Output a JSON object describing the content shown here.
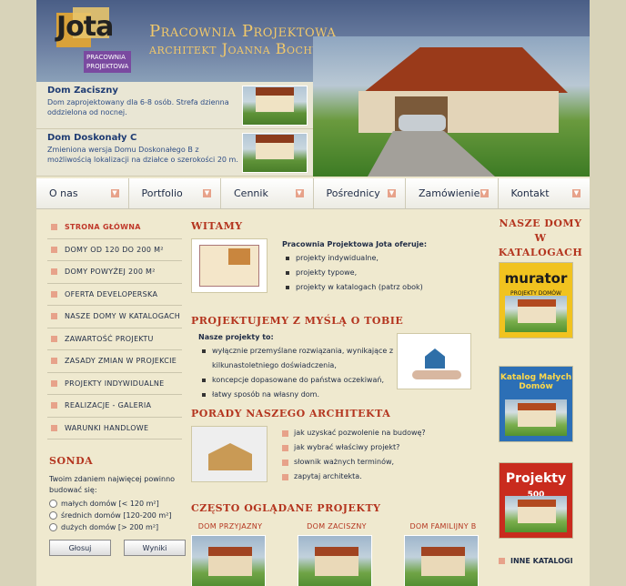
{
  "header": {
    "logo_text": "Jota",
    "logo_tag": "Pracownia Projektowa",
    "title": "Pracownia Projektowa",
    "subtitle": "architekt Joanna Bochyńska"
  },
  "featured": [
    {
      "title": "Dom Zaciszny",
      "desc": "Dom zaprojektowany dla 6-8 osób. Strefa dzienna oddzielona od nocnej."
    },
    {
      "title": "Dom Doskonały C",
      "desc": "Zmieniona wersja Domu Doskonałego B z możliwością lokalizacji na działce o szerokości 20 m."
    }
  ],
  "nav": [
    "O nas",
    "Portfolio",
    "Cennik",
    "Pośrednicy",
    "Zamówienie",
    "Kontakt"
  ],
  "sidebar": [
    "Strona główna",
    "Domy od 120 do 200 m²",
    "Domy powyżej 200 m²",
    "Oferta developerska",
    "Nasze domy w katalogach",
    "Zawartość projektu",
    "Zasady zmian w projekcie",
    "Projekty indywidualne",
    "Realizacje - Galeria",
    "Warunki handlowe"
  ],
  "sonda": {
    "title": "Sonda",
    "question": "Twoim zdaniem najwięcej powinno budować się:",
    "options": [
      "małych domów [< 120 m²]",
      "średnich domów [120-200 m²]",
      "dużych domów [> 200 m²]"
    ],
    "vote": "Głosuj",
    "results": "Wyniki"
  },
  "welcome": {
    "title": "Witamy",
    "intro": "Pracownia Projektowa Jota oferuje:",
    "items": [
      "projekty indywidualne,",
      "projekty typowe,",
      "projekty w katalogach (patrz obok)"
    ]
  },
  "design": {
    "title": "Projektujemy z myślą o tobie",
    "intro": "Nasze projekty to:",
    "items": [
      "wyłącznie przemyślane rozwiązania, wynikające z",
      "kilkunastoletniego doświadczenia,",
      "koncepcje dopasowane do państwa oczekiwań,",
      "łatwy sposób na własny dom."
    ]
  },
  "advice": {
    "title": "Porady naszego architekta",
    "items": [
      "jak uzyskać pozwolenie na budowę?",
      "jak wybrać właściwy projekt?",
      "słownik ważnych terminów,",
      "zapytaj architekta."
    ]
  },
  "popular": {
    "title": "Często oglądane projekty",
    "houses": [
      "Dom Przyjazny",
      "Dom Zaciszny",
      "Dom Familijny B"
    ]
  },
  "catalogs": {
    "title": "Nasze domy w katalogach",
    "items": [
      {
        "name": "murator",
        "sub": "Projekty domów",
        "color": "#f1c31f",
        "text_color": "#1b1b1b"
      },
      {
        "name": "Katalog Małych Domów",
        "sub": "",
        "color": "#2c6fb6",
        "text_color": "#ffd94a"
      },
      {
        "name": "Projekty",
        "sub": "500",
        "color": "#c92b1e",
        "text_color": "#ffffff"
      }
    ],
    "more": "Inne katalogi"
  }
}
